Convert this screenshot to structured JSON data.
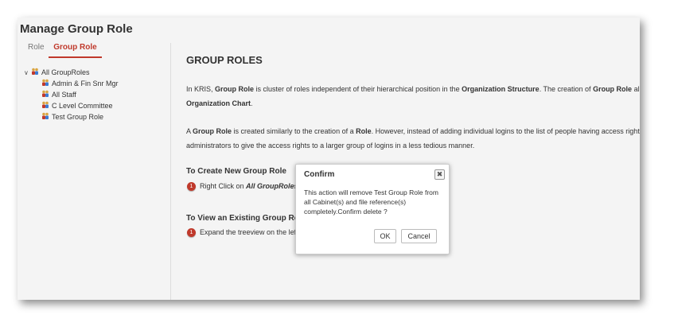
{
  "page": {
    "title": "Manage Group Role"
  },
  "tabs": [
    {
      "label": "Role",
      "active": false
    },
    {
      "label": "Group Role",
      "active": true
    }
  ],
  "tree": {
    "root": {
      "label": "All GroupRoles",
      "toggle": "∨"
    },
    "children": [
      {
        "label": "Admin & Fin Snr Mgr"
      },
      {
        "label": "All Staff"
      },
      {
        "label": "C Level Committee"
      },
      {
        "label": "Test Group Role"
      }
    ]
  },
  "content": {
    "heading": "GROUP ROLES",
    "para1": {
      "t1": "In KRIS, ",
      "b1": "Group Role",
      "t2": " is cluster of roles independent of their hierarchical position in the ",
      "b2": "Organization Structure",
      "t3": ". The creation of ",
      "b3": "Group Role",
      "t4": " allows",
      "b4": "Organization Chart",
      "t5": "."
    },
    "para2": {
      "t1": "A ",
      "b1": "Group Role",
      "t2": " is created similarly to the creation of a ",
      "b2": "Role",
      "t3": ". However, instead of adding individual logins to the list of people having access rights to",
      "line2": "administrators to give the access rights to a larger group of logins in a less tedious manner."
    },
    "section1": {
      "heading": "To Create New Group Role",
      "step_number": "1",
      "step_text": "Right Click on ",
      "step_bold": "All GroupRoles"
    },
    "section2": {
      "heading": "To View an Existing Group Role",
      "step_number": "1",
      "step_text": "Expand the treeview on the left"
    }
  },
  "dialog": {
    "title": "Confirm",
    "close_symbol": "✖",
    "message": "This action will remove Test Group Role from all Cabinet(s) and file reference(s) completely.Confirm delete ?",
    "ok_label": "OK",
    "cancel_label": "Cancel"
  },
  "colors": {
    "accent": "#c0392b",
    "group_icon_head": "#d9a441",
    "group_icon_body": "#c0392b",
    "group_icon_body2": "#3a7bd5"
  }
}
